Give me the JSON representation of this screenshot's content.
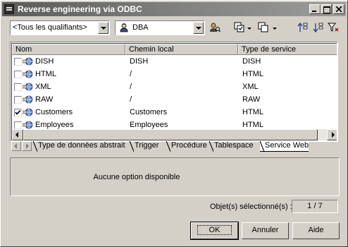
{
  "window": {
    "title": "Reverse engineering via ODBC"
  },
  "toolbar": {
    "qualifier_value": "<Tous les qualifiants>",
    "owner_value": "DBA"
  },
  "list": {
    "columns": [
      "Nom",
      "Chemin local",
      "Type de service"
    ],
    "rows": [
      {
        "name": "DISH",
        "path": "DISH",
        "type": "DISH",
        "checked": false
      },
      {
        "name": "HTML",
        "path": "/",
        "type": "HTML",
        "checked": false
      },
      {
        "name": "XML",
        "path": "/",
        "type": "XML",
        "checked": false
      },
      {
        "name": "RAW",
        "path": "/",
        "type": "RAW",
        "checked": false
      },
      {
        "name": "Customers",
        "path": "Customers",
        "type": "HTML",
        "checked": true
      },
      {
        "name": "Employees",
        "path": "Employees",
        "type": "HTML",
        "checked": false
      }
    ]
  },
  "tabs": [
    "Type de données abstrait",
    "Trigger",
    "Procédure",
    "Tablespace",
    "Service Web"
  ],
  "active_tab": "Service Web",
  "options": {
    "message": "Aucune option disponible"
  },
  "selection": {
    "label": "Objet(s) sélectionné(s) :",
    "count": "1 / 7"
  },
  "buttons": {
    "ok": "OK",
    "cancel": "Annuler",
    "help": "Aide"
  }
}
